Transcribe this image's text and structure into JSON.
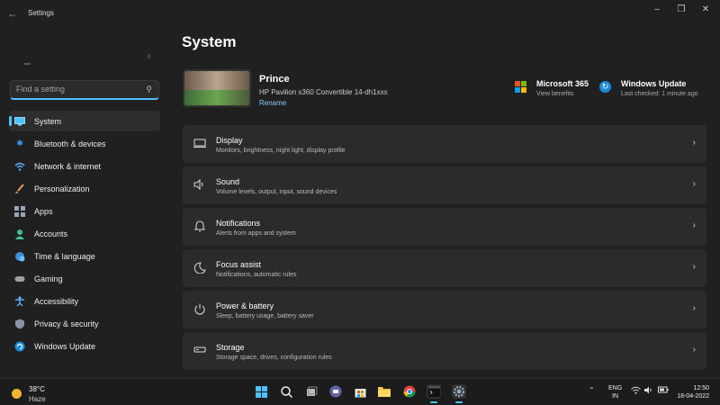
{
  "window": {
    "title": "Settings",
    "back_icon": "back-arrow-icon",
    "controls": [
      "minimize",
      "maximize",
      "close"
    ]
  },
  "search": {
    "placeholder": "Find a setting",
    "icon": "search-icon"
  },
  "sidebar": {
    "items": [
      {
        "label": "System",
        "icon": "monitor-icon",
        "active": true
      },
      {
        "label": "Bluetooth & devices",
        "icon": "bluetooth-icon"
      },
      {
        "label": "Network & internet",
        "icon": "wifi-icon"
      },
      {
        "label": "Personalization",
        "icon": "brush-icon"
      },
      {
        "label": "Apps",
        "icon": "apps-grid-icon"
      },
      {
        "label": "Accounts",
        "icon": "person-icon"
      },
      {
        "label": "Time & language",
        "icon": "globe-clock-icon"
      },
      {
        "label": "Gaming",
        "icon": "gamepad-icon"
      },
      {
        "label": "Accessibility",
        "icon": "accessibility-icon"
      },
      {
        "label": "Privacy & security",
        "icon": "shield-icon"
      },
      {
        "label": "Windows Update",
        "icon": "update-icon"
      }
    ]
  },
  "main": {
    "title": "System",
    "device": {
      "name": "Prince",
      "model": "HP Pavilion x360 Convertible 14-dh1xxx",
      "rename": "Rename"
    },
    "services": {
      "ms365": {
        "title": "Microsoft 365",
        "sub": "View benefits"
      },
      "update": {
        "title": "Windows Update",
        "sub": "Last checked: 1 minute ago"
      }
    },
    "cards": [
      {
        "title": "Display",
        "sub": "Monitors, brightness, night light, display profile",
        "icon": "display-icon"
      },
      {
        "title": "Sound",
        "sub": "Volume levels, output, input, sound devices",
        "icon": "speaker-icon"
      },
      {
        "title": "Notifications",
        "sub": "Alerts from apps and system",
        "icon": "bell-icon"
      },
      {
        "title": "Focus assist",
        "sub": "Notifications, automatic rules",
        "icon": "moon-icon"
      },
      {
        "title": "Power & battery",
        "sub": "Sleep, battery usage, battery saver",
        "icon": "power-icon"
      },
      {
        "title": "Storage",
        "sub": "Storage space, drives, configuration rules",
        "icon": "storage-icon"
      }
    ]
  },
  "taskbar": {
    "weather": {
      "temp": "38°C",
      "condition": "Haze"
    },
    "lang": {
      "line1": "ENG",
      "line2": "IN"
    },
    "clock": {
      "time": "12:50",
      "date": "18-04-2022"
    }
  },
  "colors": {
    "accent": "#4cc2ff",
    "background": "#202020",
    "card": "#2b2b2b",
    "taskbar": "#1c1c1c"
  }
}
